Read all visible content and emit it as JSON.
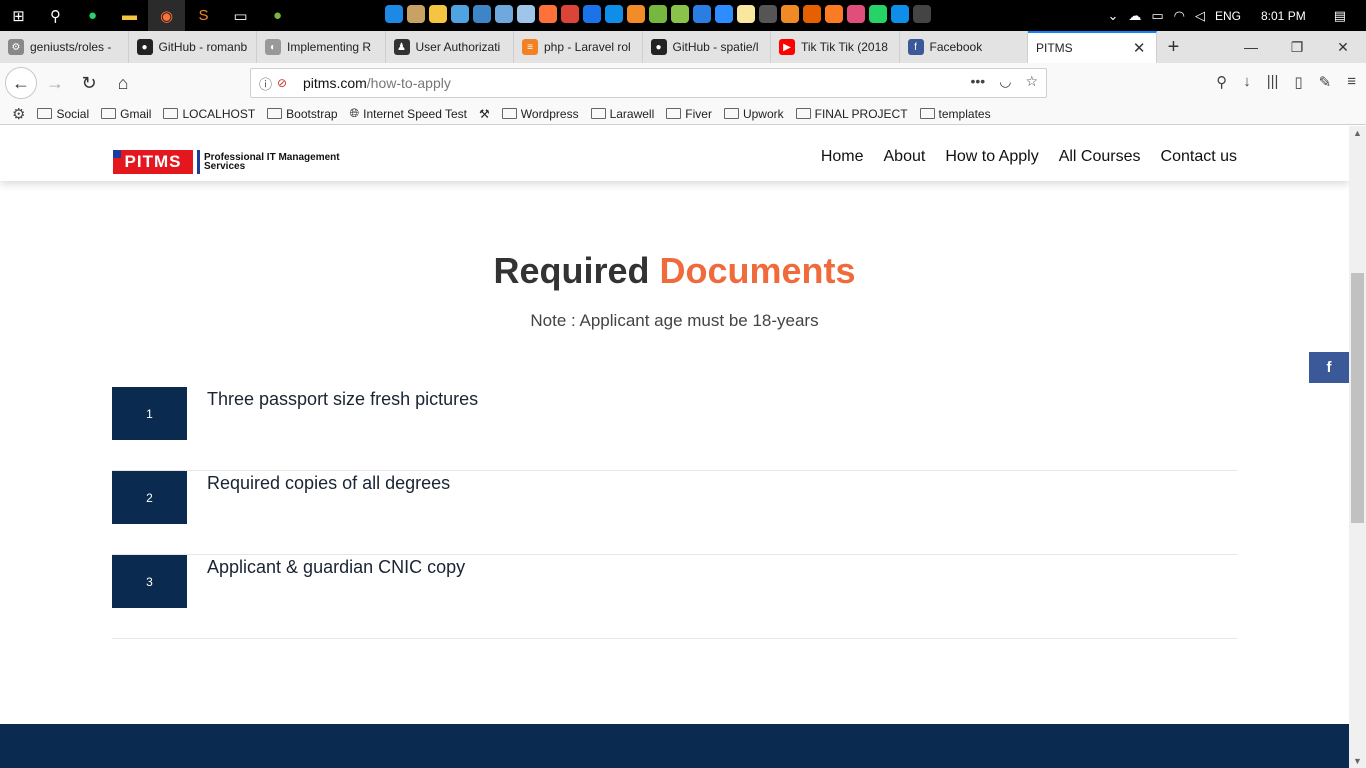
{
  "taskbar": {
    "right": {
      "lang": "ENG",
      "time": "8:01 PM"
    }
  },
  "tabs": [
    {
      "label": "geniusts/roles - ",
      "fav_color": "#888888",
      "fav": "⚙"
    },
    {
      "label": "GitHub - romanb",
      "fav_color": "#222222",
      "fav": "●"
    },
    {
      "label": "Implementing R",
      "fav_color": "#999999",
      "fav": "◐"
    },
    {
      "label": "User Authorizati",
      "fav_color": "#333333",
      "fav": "♟"
    },
    {
      "label": "php - Laravel rol",
      "fav_color": "#f48024",
      "fav": "≡"
    },
    {
      "label": "GitHub - spatie/l",
      "fav_color": "#222222",
      "fav": "●"
    },
    {
      "label": "Tik Tik Tik (2018",
      "fav_color": "#ff0000",
      "fav": "▶"
    },
    {
      "label": "Facebook",
      "fav_color": "#3b5998",
      "fav": "f"
    },
    {
      "label": "PITMS",
      "fav_color": "",
      "fav": ""
    }
  ],
  "url": {
    "host": "pitms.com",
    "path": "/how-to-apply"
  },
  "bookmarks": [
    "Social",
    "Gmail",
    "LOCALHOST",
    "Bootstrap",
    "Internet Speed Test",
    "Wordpress",
    "Larawell",
    "Fiver",
    "Upwork",
    "FINAL PROJECT",
    "templates"
  ],
  "site": {
    "logo_text": "PITMS",
    "logo_tagline_1": "Professional IT Management",
    "logo_tagline_2": "Services",
    "menu": [
      "Home",
      "About",
      "How to Apply",
      "All Courses",
      "Contact us"
    ]
  },
  "content": {
    "title_part1": "Required",
    "title_part2": "Documents",
    "note": "Note : Applicant age must be 18-years",
    "documents": [
      {
        "number": "1",
        "text": "Three passport size fresh pictures"
      },
      {
        "number": "2",
        "text": "Required copies of all degrees"
      },
      {
        "number": "3",
        "text": "Applicant & guardian CNIC copy"
      }
    ],
    "social_icon": "f"
  },
  "colors": {
    "accent": "#ef6b3b",
    "navy": "#0b2a4f",
    "facebook": "#3b5998"
  }
}
